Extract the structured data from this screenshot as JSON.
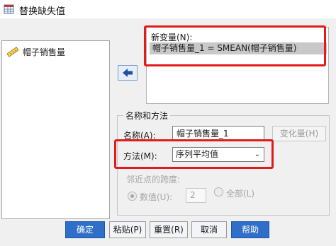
{
  "window": {
    "title": "替换缺失值",
    "icon": "spss-dataset-icon"
  },
  "variables": {
    "items": [
      {
        "label": "帽子销售量",
        "icon": "ruler-scale-icon"
      }
    ]
  },
  "move_button": {
    "icon": "arrow-left-icon"
  },
  "new_variable": {
    "label": "新变量(N):",
    "entry": "帽子销售量_1 = SMEAN(帽子销售量)"
  },
  "name_method": {
    "group_title": "名称和方法",
    "name_label": "名称(A):",
    "name_value": "帽子销售量_1",
    "change_button": "变化量(H)",
    "method_label": "方法(M):",
    "method_value": "序列平均值",
    "span_label": "邻近点的跨度:",
    "numeric_label": "数值(U):",
    "numeric_value": "2",
    "all_label": "全部(L)"
  },
  "buttons": {
    "ok": "确定",
    "paste": "粘贴(P)",
    "reset": "重置(R)",
    "cancel": "取消",
    "help": "帮助"
  },
  "highlight_color": "#e31a1a",
  "accent_color": "#2f6fc8"
}
